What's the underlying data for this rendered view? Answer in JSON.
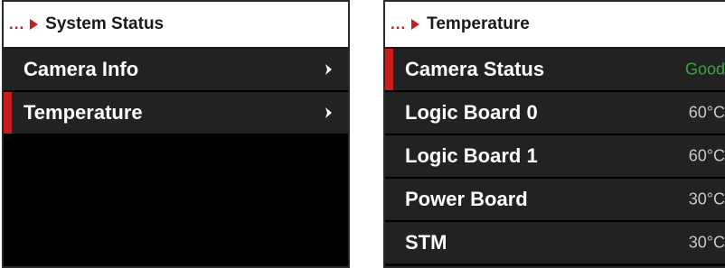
{
  "left_screen": {
    "breadcrumb_ellipsis": "...",
    "title": "System Status",
    "items": [
      {
        "label": "Camera Info"
      },
      {
        "label": "Temperature"
      }
    ]
  },
  "right_screen": {
    "breadcrumb_ellipsis": "...",
    "title": "Temperature",
    "rows": [
      {
        "label": "Camera Status",
        "value": "Good"
      },
      {
        "label": "Logic Board 0",
        "value": "60°C"
      },
      {
        "label": "Logic Board 1",
        "value": "60°C"
      },
      {
        "label": "Power Board",
        "value": "30°C"
      },
      {
        "label": "STM",
        "value": "30°C"
      }
    ]
  },
  "colors": {
    "accent": "#c41e1e",
    "status_good": "#3aa83a",
    "row_bg": "#222222",
    "screen_bg": "#000000",
    "header_bg": "#ffffff"
  },
  "icons": {
    "breadcrumb_arrow": "right-arrow-icon",
    "menu_chevron": "chevron-right-icon"
  }
}
